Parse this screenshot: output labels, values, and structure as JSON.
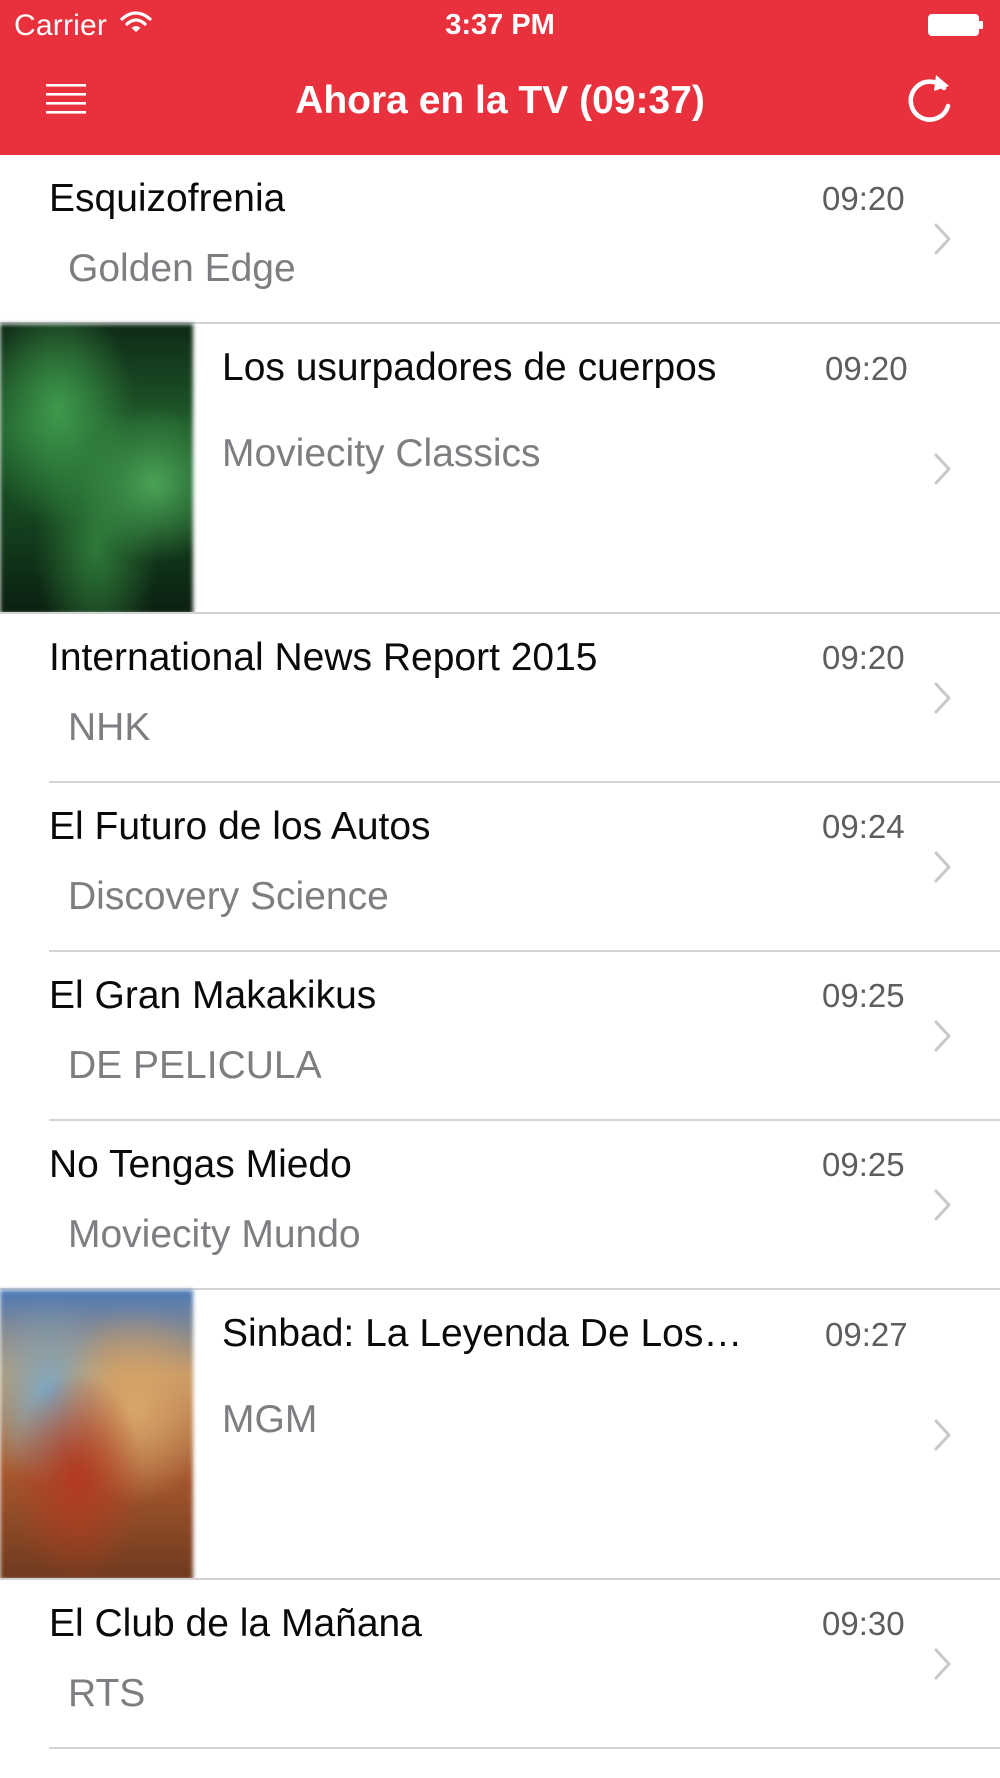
{
  "status_bar": {
    "carrier": "Carrier",
    "time": "3:37 PM"
  },
  "nav": {
    "title": "Ahora en la TV (09:37)",
    "menu_icon": "hamburger-menu-icon",
    "refresh_icon": "refresh-icon"
  },
  "colors": {
    "header_bg": "#e8313d",
    "title_text": "#0a0a0a",
    "channel_text": "#7e7e82",
    "time_text": "#5e5e62",
    "separator": "#d3d3d6"
  },
  "programs": [
    {
      "title": "Esquizofrenia",
      "channel": "Golden Edge",
      "time": "09:20",
      "has_image": false
    },
    {
      "title": "Los usurpadores de cuerpos",
      "channel": "Moviecity Classics",
      "time": "09:20",
      "has_image": true
    },
    {
      "title": "International News Report 2015",
      "channel": "NHK",
      "time": "09:20",
      "has_image": false
    },
    {
      "title": "El Futuro de los Autos",
      "channel": "Discovery Science",
      "time": "09:24",
      "has_image": false
    },
    {
      "title": "El Gran Makakikus",
      "channel": "DE PELICULA",
      "time": "09:25",
      "has_image": false
    },
    {
      "title": "No Tengas Miedo",
      "channel": "Moviecity Mundo",
      "time": "09:25",
      "has_image": false
    },
    {
      "title": "Sinbad: La Leyenda De Los…",
      "channel": "MGM",
      "time": "09:27",
      "has_image": true
    },
    {
      "title": "El Club de la Mañana",
      "channel": "RTS",
      "time": "09:30",
      "has_image": false
    }
  ]
}
